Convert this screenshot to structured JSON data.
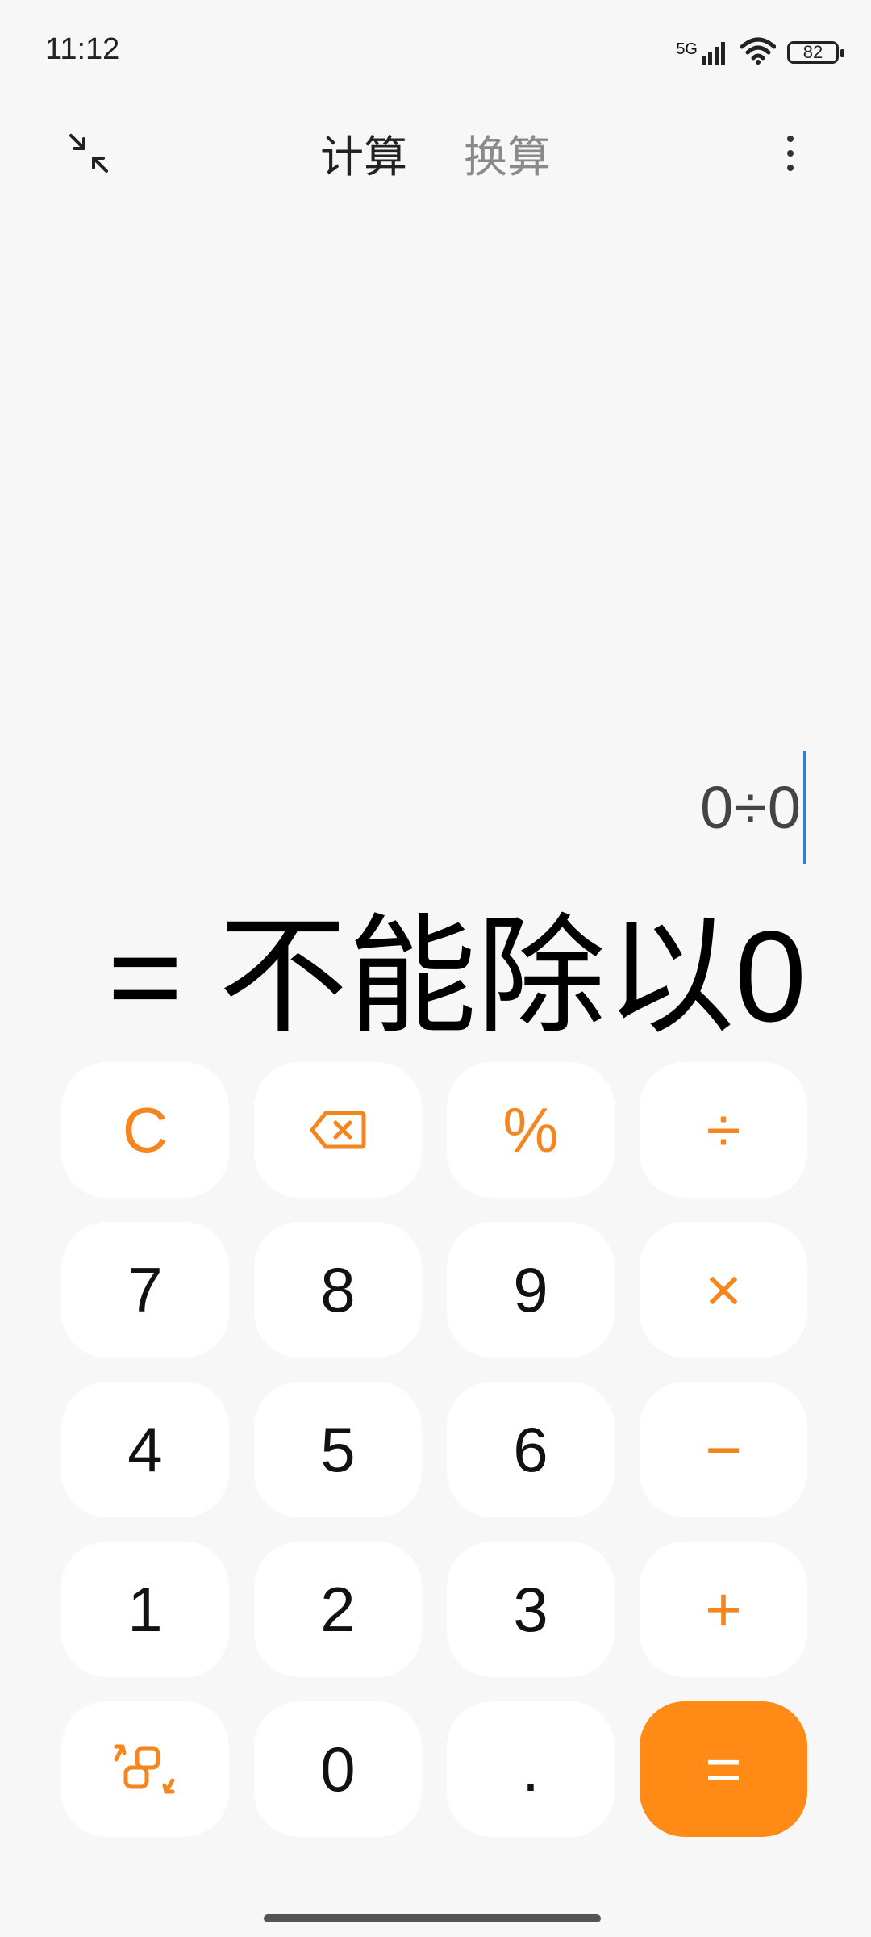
{
  "status": {
    "time": "11:12",
    "network": "5G",
    "battery": "82"
  },
  "top_bar": {
    "tabs": [
      {
        "label": "计算",
        "active": true
      },
      {
        "label": "换算",
        "active": false
      }
    ]
  },
  "display": {
    "expression": "0÷0",
    "result": "= 不能除以0"
  },
  "keys": [
    {
      "label": "C",
      "type": "op"
    },
    {
      "label": "",
      "icon": "backspace-icon",
      "type": "op"
    },
    {
      "label": "%",
      "type": "op"
    },
    {
      "label": "÷",
      "type": "op"
    },
    {
      "label": "7",
      "type": "num"
    },
    {
      "label": "8",
      "type": "num"
    },
    {
      "label": "9",
      "type": "num"
    },
    {
      "label": "×",
      "type": "op"
    },
    {
      "label": "4",
      "type": "num"
    },
    {
      "label": "5",
      "type": "num"
    },
    {
      "label": "6",
      "type": "num"
    },
    {
      "label": "−",
      "type": "op"
    },
    {
      "label": "1",
      "type": "num"
    },
    {
      "label": "2",
      "type": "num"
    },
    {
      "label": "3",
      "type": "num"
    },
    {
      "label": "+",
      "type": "op"
    },
    {
      "label": "",
      "icon": "swap-mode-icon",
      "type": "op"
    },
    {
      "label": "0",
      "type": "num"
    },
    {
      "label": ".",
      "type": "num"
    },
    {
      "label": "=",
      "type": "equals"
    }
  ],
  "colors": {
    "accent": "#ff8a16",
    "operator": "#f5861f",
    "background": "#f7f7f7",
    "key_background": "#ffffff",
    "cursor": "#3a7bd5"
  }
}
